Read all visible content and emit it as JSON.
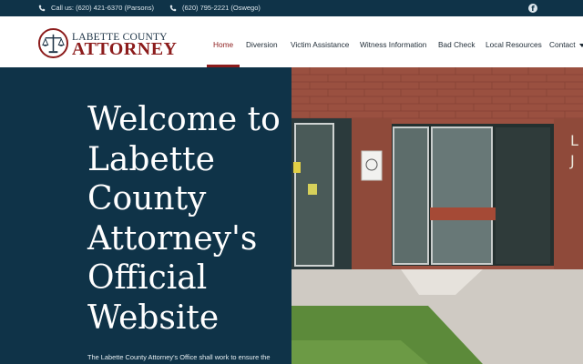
{
  "topbar": {
    "phone1": "Call us: (620) 421-6370 (Parsons)",
    "phone2": "(620) 795-2221 (Oswego)",
    "social_icon": "facebook-icon"
  },
  "logo": {
    "line1": "LABETTE COUNTY",
    "line2": "ATTORNEY"
  },
  "nav": {
    "items": [
      "Home",
      "Diversion",
      "Victim Assistance",
      "Witness Information",
      "Bad Check",
      "Local Resources",
      "Contact"
    ]
  },
  "hero": {
    "title": "Welcome to Labette County Attorney's Official Website",
    "text": "The Labette County Attorney's Office shall work to ensure the"
  },
  "colors": {
    "navy": "#0f3348",
    "brand_red": "#8c1c1c"
  }
}
